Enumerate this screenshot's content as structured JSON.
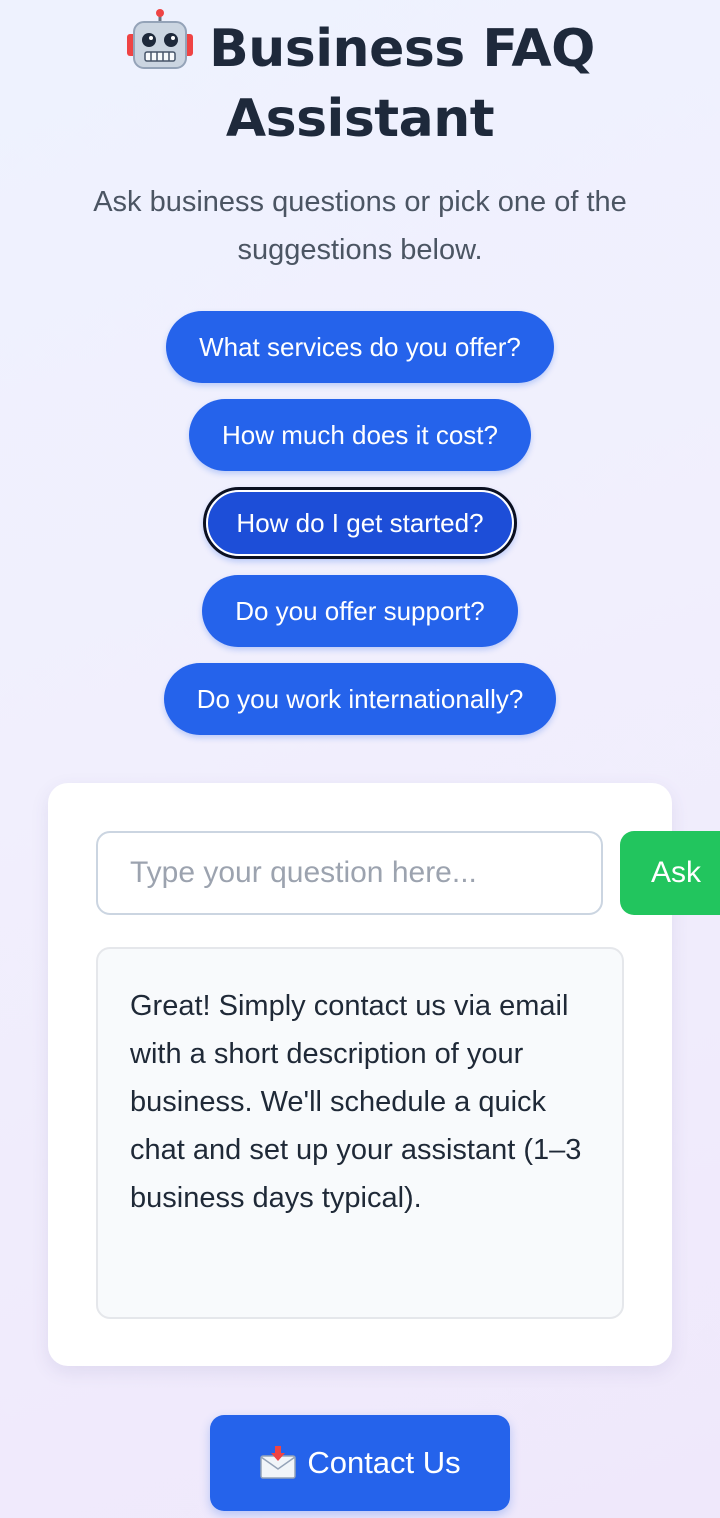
{
  "header": {
    "icon": "robot-icon",
    "title": "Business FAQ Assistant",
    "subtitle": "Ask business questions or pick one of the suggestions below."
  },
  "suggestions": [
    "What services do you offer?",
    "How much does it cost?",
    "How do I get started?",
    "Do you offer support?",
    "Do you work internationally?"
  ],
  "question_input": {
    "value": "",
    "placeholder": "Type your question here..."
  },
  "ask_label": "Ask",
  "answer": "Great! Simply contact us via email with a short description of your business. We'll schedule a quick chat and set up your assistant (1–3 business days typical).",
  "contact": {
    "icon": "envelope-icon",
    "label": "Contact Us"
  },
  "colors": {
    "primary": "#2563eb",
    "ask": "#22c55e"
  }
}
